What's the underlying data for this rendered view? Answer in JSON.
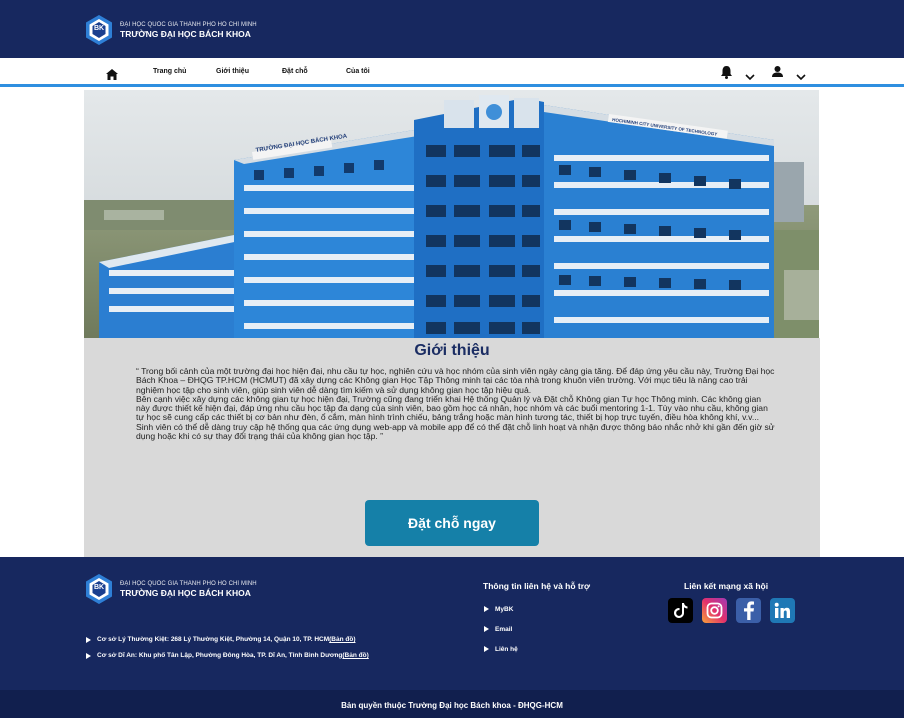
{
  "header": {
    "logo_small": "ĐẠI HỌC QUỐC GIA THÀNH PHỐ HỒ CHÍ MINH",
    "logo_big": "TRƯỜNG ĐẠI HỌC BÁCH KHOA",
    "logo_mark": "BK"
  },
  "nav": {
    "items": [
      "Trang chủ",
      "Giới thiệu",
      "Đặt chỗ",
      "Của tôi"
    ]
  },
  "hero": {
    "sign_left": "TRƯỜNG ĐẠI HỌC BÁCH KHOA",
    "sign_right": "HOCHIMINH CITY UNIVERSITY OF TECHNOLOGY"
  },
  "intro": {
    "title": "Giới thiệu",
    "body": "“ Trong bối cảnh của một trường đại học hiện đại, nhu cầu tự học, nghiên cứu và học nhóm của sinh viên ngày càng gia tăng. Để đáp ứng yêu cầu này, Trường Đại học Bách Khoa – ĐHQG TP.HCM (HCMUT) đã xây dựng các Không gian Học Tập Thông minh tại các tòa nhà trong khuôn viên trường. Với mục tiêu là nâng cao trải nghiệm học tập cho sinh viên, giúp sinh viên dễ dàng tìm kiếm và sử dụng không gian học tập hiệu quả.\nBên cạnh việc xây dựng các không gian tự học hiện đại, Trường cũng đang triển khai Hệ thống Quản lý và Đặt chỗ Không gian Tự học Thông minh. Các không gian này được thiết  kế hiện đại, đáp ứng nhu cầu học tập đa dạng của sinh viên, bao gồm học cá nhân, học nhóm và các buổi mentoring 1-1. Tùy vào nhu cầu, không gian tự học sẽ cung cấp các thiết bị cơ bản như đèn, ổ cắm, màn hình trình chiếu, bảng trắng hoặc màn hình tương tác, thiết bị họp trực tuyến, điều hòa không khí, v.v...\nSinh viên có thể dễ dàng truy cập hệ thống qua các ứng dụng web-app và mobile app để có thể đặt chỗ linh hoạt và nhận được thông báo nhắc nhở khi gần đến giờ sử dụng hoặc khi có sự thay đổi trạng thái của không gian học tập. ”",
    "cta": "Đặt chỗ ngay"
  },
  "footer": {
    "logo_small": "ĐẠI HỌC QUỐC GIA THÀNH PHỐ HỒ CHÍ MINH",
    "logo_big": "TRƯỜNG ĐẠI HỌC BÁCH KHOA",
    "addresses": [
      {
        "text": "Cơ sở Lý Thường Kiệt: 268 Lý Thường Kiệt, Phường 14, Quận 10, TP. HCM ",
        "link": "(Bản đồ)"
      },
      {
        "text": "Cơ sở Dĩ An: Khu phố Tân Lập, Phường Đông Hòa, TP. Dĩ An, Tỉnh Bình Dương ",
        "link": "(Bản đồ)"
      }
    ],
    "contact_title": "Thông tin liên hệ và hỗ trợ",
    "contact_links": [
      "MyBK",
      "Email",
      "Liên hệ"
    ],
    "social_title": "Liên kết mạng xã hội",
    "social_icons": [
      "tiktok-icon",
      "instagram-icon",
      "facebook-icon",
      "linkedin-icon"
    ],
    "copyright": "Bản quyền thuộc Trường Đại học Bách khoa - ĐHQG-HCM"
  },
  "colors": {
    "navy": "#17285f",
    "accent_blue": "#2f8fe0",
    "cta": "#1580a8",
    "panel_gray": "#d9d9d9"
  }
}
